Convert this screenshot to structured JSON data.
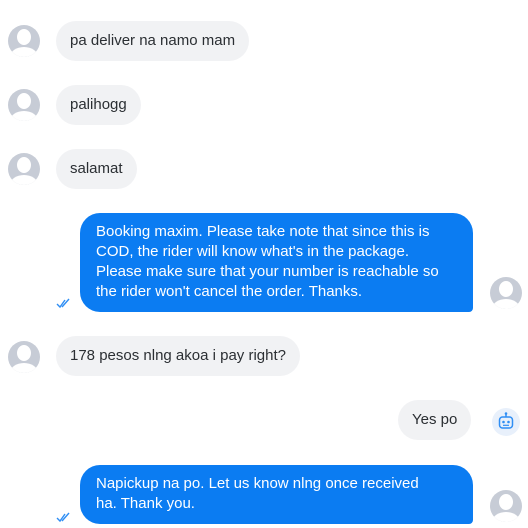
{
  "messages": [
    {
      "from": "customer",
      "text": "pa deliver na namo mam"
    },
    {
      "from": "customer",
      "text": "palihogg"
    },
    {
      "from": "customer",
      "text": "salamat"
    },
    {
      "from": "agent",
      "lines": [
        "Booking maxim. Please take note that since this is",
        "COD, the rider will know what's in the package.",
        "Please make sure that your number is reachable so",
        "the rider won't cancel the order. Thanks."
      ]
    },
    {
      "from": "customer",
      "text": "178 pesos nlng akoa i pay right?"
    },
    {
      "from": "bot",
      "text": "Yes po"
    },
    {
      "from": "agent",
      "lines": [
        "Napickup na po. Let us know nlng once received",
        "ha. Thank you."
      ]
    }
  ],
  "icons": {
    "avatar": "user-avatar-icon",
    "read_receipt": "double-check-icon",
    "bot": "bot-icon"
  },
  "colors": {
    "agent_bubble": "#0b7cf2",
    "customer_bubble": "#f1f2f4",
    "avatar": "#c7ccd6",
    "read_check": "#2f8ef4"
  }
}
